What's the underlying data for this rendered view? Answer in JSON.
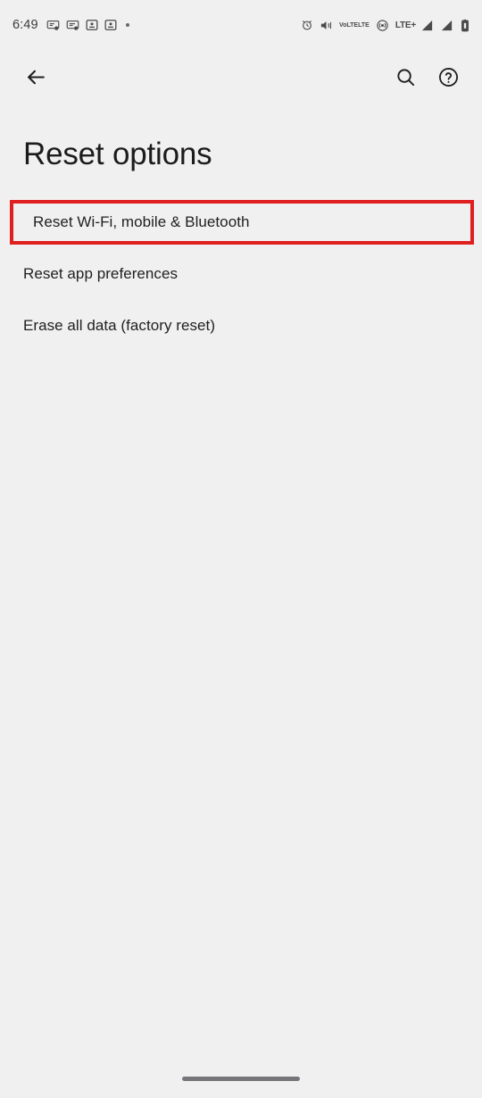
{
  "status_bar": {
    "time": "6:49",
    "left_icons": [
      {
        "name": "notification-screenshot-icon"
      },
      {
        "name": "notification-message-icon"
      },
      {
        "name": "notification-app-icon-1"
      },
      {
        "name": "notification-app-icon-2"
      },
      {
        "name": "notification-overflow-dot"
      }
    ],
    "right_icons": [
      {
        "name": "alarm-icon"
      },
      {
        "name": "vibrate-icon"
      },
      {
        "name": "volte-icon",
        "label_top": "VoLTE",
        "label_bottom": "LTE"
      },
      {
        "name": "hotspot-icon"
      },
      {
        "name": "lte-plus-icon",
        "label": "LTE+"
      },
      {
        "name": "signal-bars-icon-sim1"
      },
      {
        "name": "signal-bars-icon-sim2"
      },
      {
        "name": "battery-icon"
      }
    ]
  },
  "app_bar": {
    "back_label": "Back",
    "search_label": "Search",
    "help_label": "Help"
  },
  "page": {
    "title": "Reset options"
  },
  "options": [
    {
      "label": "Reset Wi-Fi, mobile & Bluetooth",
      "highlighted": true
    },
    {
      "label": "Reset app preferences",
      "highlighted": false
    },
    {
      "label": "Erase all data (factory reset)",
      "highlighted": false
    }
  ],
  "navigation": {
    "gesture_pill_label": "Home gesture bar"
  },
  "colors": {
    "background": "#f1f0f0",
    "text_primary": "#1f1f1f",
    "highlight_red": "#e01f1f",
    "status_icon": "#4a4a4a",
    "nav_pill": "#76767a"
  }
}
